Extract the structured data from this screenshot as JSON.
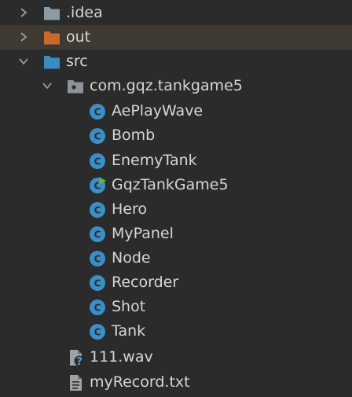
{
  "tree": {
    "idea_folder": {
      "label": ".idea",
      "icon": "folder-icon",
      "color": "#8a9aa6"
    },
    "out_folder": {
      "label": "out",
      "icon": "folder-icon",
      "color": "#c9692a",
      "highlighted": true
    },
    "src_folder": {
      "label": "src",
      "icon": "folder-icon",
      "color": "#3a8bc2"
    },
    "package": {
      "label": "com.gqz.tankgame5",
      "icon": "package-icon",
      "color": "#8c959c"
    },
    "classes": [
      {
        "label": "AePlayWave",
        "icon": "class-icon"
      },
      {
        "label": "Bomb",
        "icon": "class-icon"
      },
      {
        "label": "EnemyTank",
        "icon": "class-icon"
      },
      {
        "label": "GqzTankGame5",
        "icon": "main-class-icon"
      },
      {
        "label": "Hero",
        "icon": "class-icon"
      },
      {
        "label": "MyPanel",
        "icon": "class-icon"
      },
      {
        "label": "Node",
        "icon": "class-icon"
      },
      {
        "label": "Recorder",
        "icon": "class-icon"
      },
      {
        "label": "Shot",
        "icon": "class-icon"
      },
      {
        "label": "Tank",
        "icon": "class-icon"
      }
    ],
    "files": [
      {
        "label": "111.wav",
        "icon": "unknown-file-icon"
      },
      {
        "label": "myRecord.txt",
        "icon": "text-file-icon"
      }
    ],
    "class_icon_color": "#3b8fc8",
    "class_letter": "C"
  }
}
